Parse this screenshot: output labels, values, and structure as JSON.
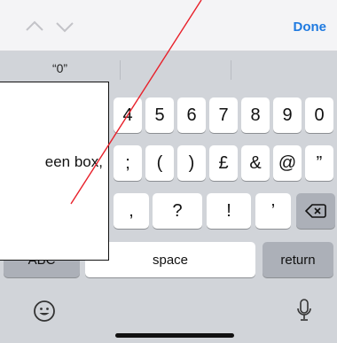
{
  "toolbar": {
    "done_label": "Done",
    "prev_icon": "chevron-up-icon",
    "next_icon": "chevron-down-icon"
  },
  "suggestions": [
    "“0”",
    "",
    ""
  ],
  "keys": {
    "row1": [
      "4",
      "5",
      "6",
      "7",
      "8",
      "9",
      "0"
    ],
    "row2": [
      ";",
      "(",
      ")",
      "£",
      "&",
      "@",
      "”"
    ],
    "row3": [
      ",",
      "?",
      "!",
      "’"
    ],
    "delete_icon": "backspace-icon",
    "abc_label": "ABC",
    "space_label": "space",
    "return_label": "return",
    "emoji_icon": "emoji-icon",
    "mic_icon": "microphone-icon"
  },
  "callout": {
    "text": "een box,"
  },
  "colors": {
    "accent": "#1f7ae0",
    "line": "#e8202a"
  }
}
